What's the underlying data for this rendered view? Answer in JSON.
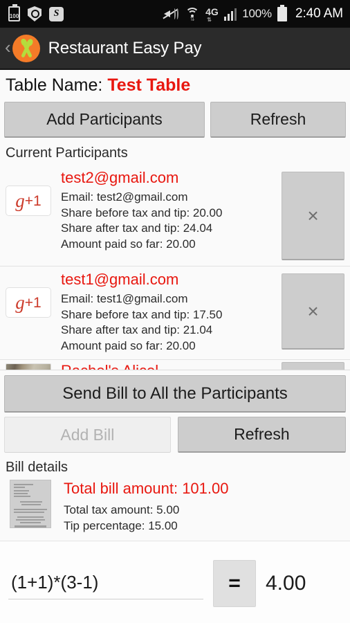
{
  "status_bar": {
    "left_icons": [
      "battery-100-badge-icon",
      "shield-scan-icon",
      "s-app-icon"
    ],
    "battery_badge_text": "100",
    "s_badge_text": "S",
    "right_icons": [
      "mute-vibrate-icon",
      "wifi-icon",
      "network-4g-lte-icon",
      "signal-bars-icon"
    ],
    "network_label": "4G",
    "battery_percent": "100%",
    "time": "2:40 AM"
  },
  "action_bar": {
    "back_label": "‹",
    "app_name": "Restaurant Easy Pay",
    "logo_colors": {
      "circle": "#f47b28",
      "utensils": "#b5dd3c"
    }
  },
  "table": {
    "name_label": "Table Name:",
    "name_value": "Test Table",
    "add_participants_label": "Add Participants",
    "refresh_label": "Refresh"
  },
  "participants": {
    "section_label": "Current Participants",
    "remove_icon_glyph": "×",
    "avatar_g": "g",
    "avatar_plus_one": "+1",
    "items": [
      {
        "title": "test2@gmail.com",
        "email_line": "Email: test2@gmail.com",
        "share_before_line": "Share before tax and tip: 20.00",
        "share_after_line": "Share after tax and tip: 24.04",
        "paid_line": "Amount paid so far: 20.00",
        "avatar_type": "gplus"
      },
      {
        "title": "test1@gmail.com",
        "email_line": "Email: test1@gmail.com",
        "share_before_line": "Share before tax and tip: 17.50",
        "share_after_line": "Share after tax and tip: 21.04",
        "paid_line": "Amount paid so far: 20.00",
        "avatar_type": "gplus"
      },
      {
        "title": "Rachel's Alicel",
        "avatar_type": "photo"
      }
    ]
  },
  "bill_actions": {
    "send_bill_label": "Send Bill to All the Participants",
    "add_bill_label": "Add Bill",
    "add_bill_disabled": true,
    "refresh_label": "Refresh"
  },
  "bill_details": {
    "section_label": "Bill details",
    "total_line": "Total bill amount: 101.00",
    "tax_line": "Total tax amount: 5.00",
    "tip_line": "Tip percentage: 15.00",
    "thumbnail": "receipt-photo"
  },
  "calculator": {
    "expression": "(1+1)*(3-1)",
    "placeholder": "",
    "equals_label": "=",
    "result": "4.00"
  },
  "colors": {
    "accent_red": "#e8170f",
    "status_bar_bg": "#0b0b0b",
    "action_bar_bg": "#2b2b2b",
    "page_bg": "#fafafa",
    "button_bg": "#cdcdcd"
  }
}
